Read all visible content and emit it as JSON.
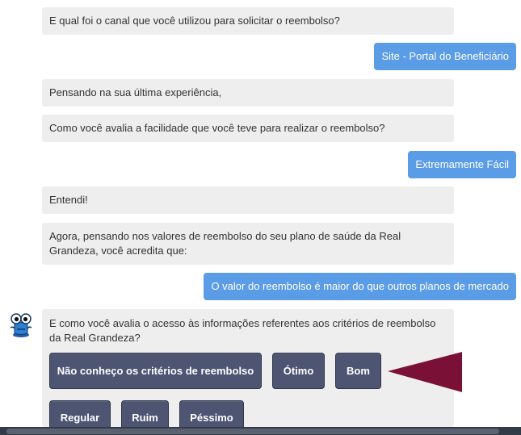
{
  "messages": [
    {
      "from": "bot",
      "text": "E qual foi o canal que você utilizou para solicitar o reembolso?"
    },
    {
      "from": "user",
      "text": "Site - Portal do Beneficiário"
    },
    {
      "from": "bot",
      "text": "Pensando na sua última experiência,"
    },
    {
      "from": "bot",
      "text": "Como você avalia a facilidade que você teve para realizar o reembolso?"
    },
    {
      "from": "user",
      "text": "Extremamente Fácil"
    },
    {
      "from": "bot",
      "text": "Entendi!"
    },
    {
      "from": "bot",
      "text": "Agora, pensando nos valores de reembolso do seu plano de saúde da Real Grandeza, você acredita que:"
    },
    {
      "from": "user",
      "text": "O valor do reembolso é maior do que outros planos de mercado"
    },
    {
      "from": "bot",
      "text": "E como você avalia o acesso às informações referentes aos critérios de reembolso da Real Grandeza?"
    }
  ],
  "options": [
    "Não conheço os critérios de reembolso",
    "Ótimo",
    "Bom",
    "Regular",
    "Ruim",
    "Péssimo"
  ],
  "colors": {
    "user_bubble": "#5b9ce6",
    "bot_bubble": "#eeeeee",
    "option_button": "#4d5572",
    "pointer_arrow": "#7a1035"
  },
  "icons": {
    "avatar": "robot-mascot-icon",
    "pointer": "pointer-arrow-icon"
  }
}
